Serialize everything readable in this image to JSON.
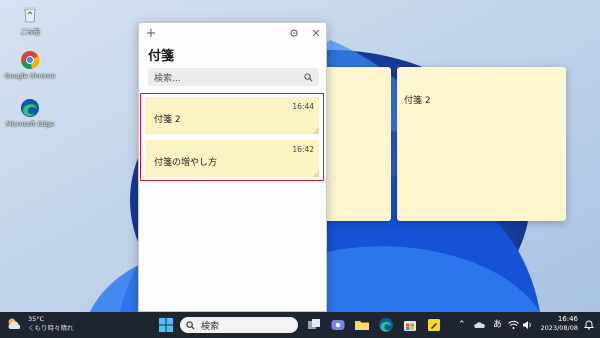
{
  "desktop": {
    "icons": [
      {
        "label": "ごみ箱",
        "icon": "recycle-bin-icon"
      },
      {
        "label": "Google Chrome",
        "icon": "chrome-icon"
      },
      {
        "label": "Microsoft Edge",
        "icon": "edge-icon"
      }
    ]
  },
  "sticky_notes": {
    "title": "付箋",
    "search_placeholder": "検索...",
    "add_icon": "+",
    "settings_icon": "⚙",
    "close_icon": "✕",
    "notes": [
      {
        "title": "付箋 2",
        "time": "16:44"
      },
      {
        "title": "付箋の増やし方",
        "time": "16:42"
      }
    ],
    "accent": "#d0182b",
    "note_color": "#fcf3c4"
  },
  "open_note": {
    "text": "付箋 2"
  },
  "taskbar": {
    "weather": {
      "temp": "35°C",
      "desc": "くもり時々晴れ"
    },
    "search_label": "検索",
    "tray": {
      "ime": "あ",
      "time": "16:46",
      "date": "2023/08/08"
    }
  }
}
